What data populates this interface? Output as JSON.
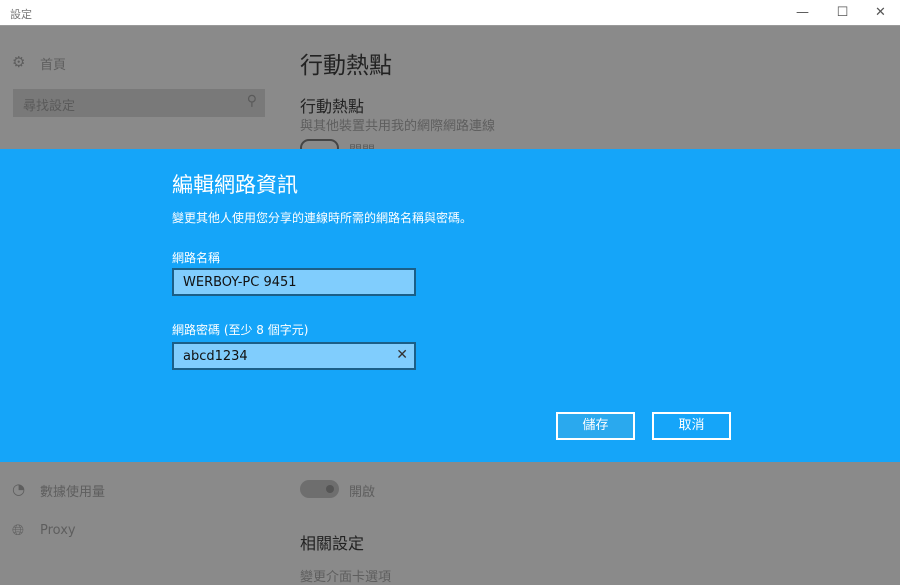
{
  "window": {
    "title": "設定",
    "minimize": "—",
    "maximize": "☐",
    "close": "✕"
  },
  "sidebar": {
    "home": "首頁",
    "search_placeholder": "尋找設定",
    "items": [
      {
        "label": "數據使用量",
        "icon": "pie-chart-icon"
      },
      {
        "label": "Proxy",
        "icon": "globe-icon"
      }
    ]
  },
  "main": {
    "page_title": "行動熱點",
    "section_title": "行動熱點",
    "section_desc": "與其他裝置共用我的網際網路連線",
    "toggle1_state": "關閉",
    "toggle2_state": "開啟",
    "related_title": "相關設定",
    "related_link": "變更介面卡選項"
  },
  "dialog": {
    "title": "編輯網路資訊",
    "description": "變更其他人使用您分享的連線時所需的網路名稱與密碼。",
    "name_label": "網路名稱",
    "name_value": "WERBOY-PC 9451",
    "password_label": "網路密碼 (至少 8 個字元)",
    "password_value": "abcd1234",
    "save": "儲存",
    "cancel": "取消",
    "accent": "#15a5f9"
  }
}
